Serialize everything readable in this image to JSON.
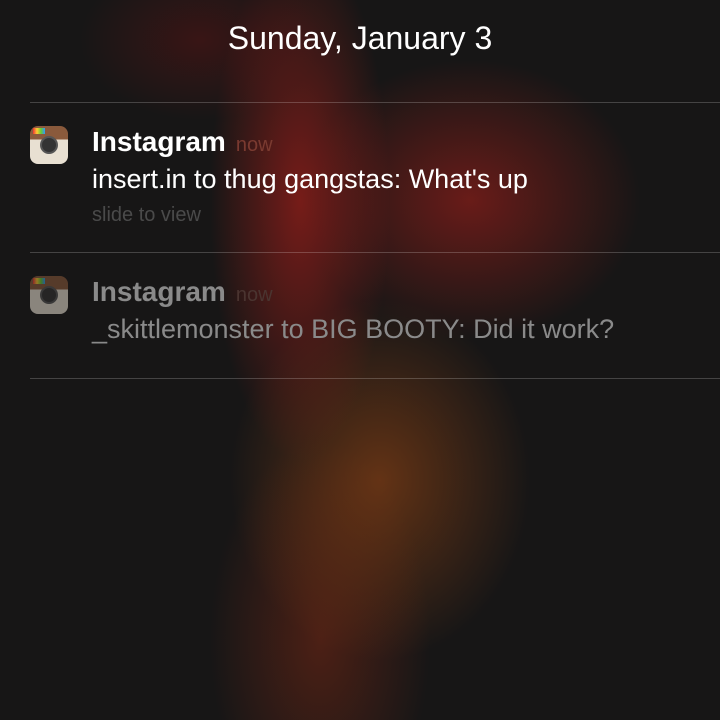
{
  "date": "Sunday, January 3",
  "notifications": [
    {
      "app": "Instagram",
      "time": "now",
      "message": "insert.in to thug gangstas: What's up",
      "hint": "slide to view"
    },
    {
      "app": "Instagram",
      "time": "now",
      "message": "_skittlemonster to BIG BOOTY: Did it work?"
    }
  ]
}
